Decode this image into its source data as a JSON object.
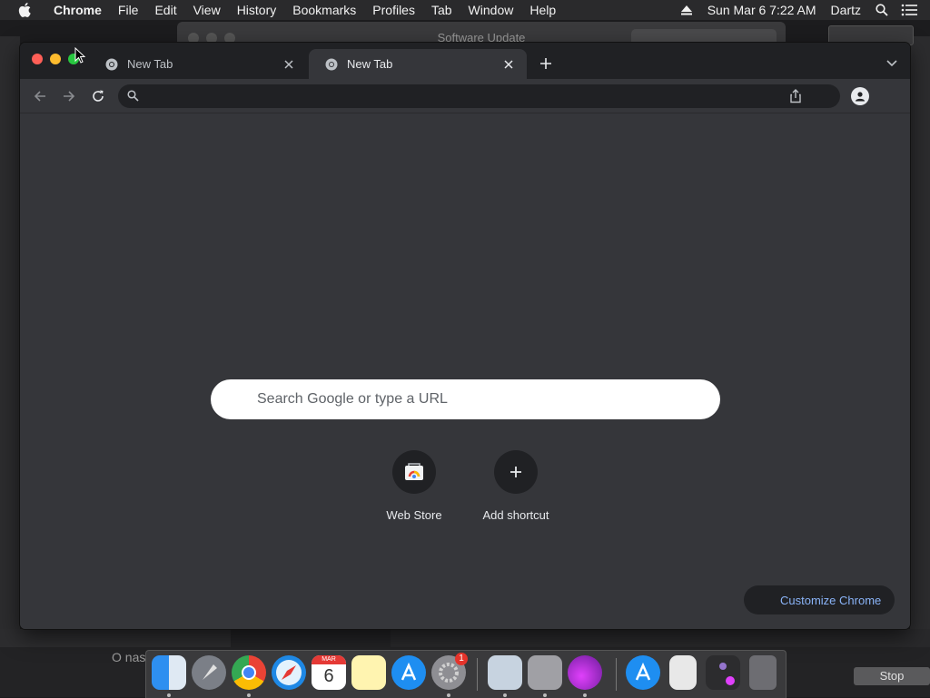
{
  "menubar": {
    "app_name": "Chrome",
    "items": [
      "File",
      "Edit",
      "View",
      "History",
      "Bookmarks",
      "Profiles",
      "Tab",
      "Window",
      "Help"
    ],
    "datetime": "Sun Mar 6  7:22 AM",
    "user": "Dartz"
  },
  "background": {
    "window_title": "Software Update",
    "partial_text": "O nas",
    "stop_label": "Stop"
  },
  "chrome": {
    "tabs": [
      {
        "label": "New Tab",
        "active": false
      },
      {
        "label": "New Tab",
        "active": true
      }
    ],
    "omnibox_value": "",
    "ntp": {
      "search_placeholder": "Search Google or type a URL",
      "shortcuts": [
        {
          "label": "Web Store",
          "icon": "web-store-icon"
        },
        {
          "label": "Add shortcut",
          "icon": "plus-icon"
        }
      ],
      "customize_label": "Customize Chrome"
    }
  },
  "dock": {
    "apps": [
      "Finder",
      "Launchpad",
      "Chrome",
      "Safari",
      "Calendar",
      "Notes",
      "App Store",
      "System Preferences",
      "Preview",
      "Archive Utility",
      "Instruments",
      "App Store Downloads",
      "Document",
      "Stack",
      "Trash"
    ],
    "calendar_month": "MAR",
    "calendar_day": "6",
    "system_prefs_badge": "1"
  },
  "colors": {
    "chrome_frame": "#202124",
    "chrome_surface": "#35363a",
    "link_blue": "#8ab4f8"
  }
}
